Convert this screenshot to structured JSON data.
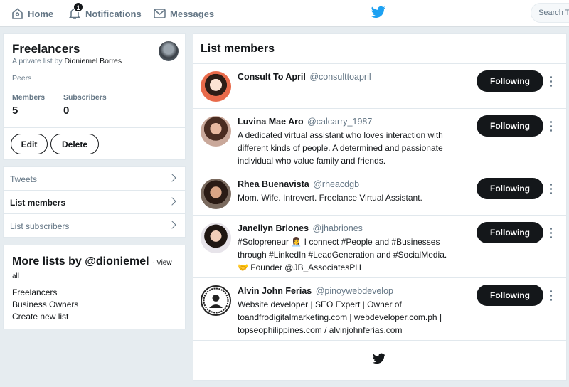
{
  "nav": {
    "home": "Home",
    "notifications": "Notifications",
    "notification_count": "1",
    "messages": "Messages",
    "search_placeholder": "Search Tw"
  },
  "list": {
    "name": "Freelancers",
    "by_prefix": "A private list by",
    "owner": "Dioniemel Borres",
    "description": "Peers",
    "members_label": "Members",
    "members_count": "5",
    "subscribers_label": "Subscribers",
    "subscribers_count": "0",
    "edit_label": "Edit",
    "delete_label": "Delete"
  },
  "sidebar_nav": [
    {
      "label": "Tweets"
    },
    {
      "label": "List members"
    },
    {
      "label": "List subscribers"
    }
  ],
  "more_lists": {
    "title": "More lists by @dioniemel",
    "view_all": "· View all",
    "items": [
      "Freelancers",
      "Business Owners",
      "Create new list"
    ]
  },
  "main": {
    "title": "List members",
    "following_label": "Following",
    "members": [
      {
        "name": "Consult To April",
        "handle": "@consulttoapril",
        "bio": ""
      },
      {
        "name": "Luvina Mae Aro",
        "handle": "@calcarry_1987",
        "bio": "A dedicated virtual assistant who loves interaction with different kinds of people. A determined and passionate individual who value family and friends."
      },
      {
        "name": "Rhea Buenavista",
        "handle": "@rheacdgb",
        "bio": "Mom. Wife. Introvert. Freelance Virtual Assistant."
      },
      {
        "name": "Janellyn Briones",
        "handle": "@jhabriones",
        "bio": "#Solopreneur 👩‍💼 I connect #People and #Businesses through #LinkedIn #LeadGeneration and #SocialMedia. 🤝 Founder @JB_AssociatesPH"
      },
      {
        "name": "Alvin John Ferias",
        "handle": "@pinoywebdevelop",
        "bio": "Website developer | SEO Expert | Owner of toandfrodigitalmarketing.com | webdeveloper.com.ph | topseophilippines.com / alvinjohnferias.com"
      }
    ]
  },
  "colors": {
    "brand": "#1da1f2",
    "text": "#14171a",
    "muted": "#657786",
    "background": "#e6ecf0"
  }
}
